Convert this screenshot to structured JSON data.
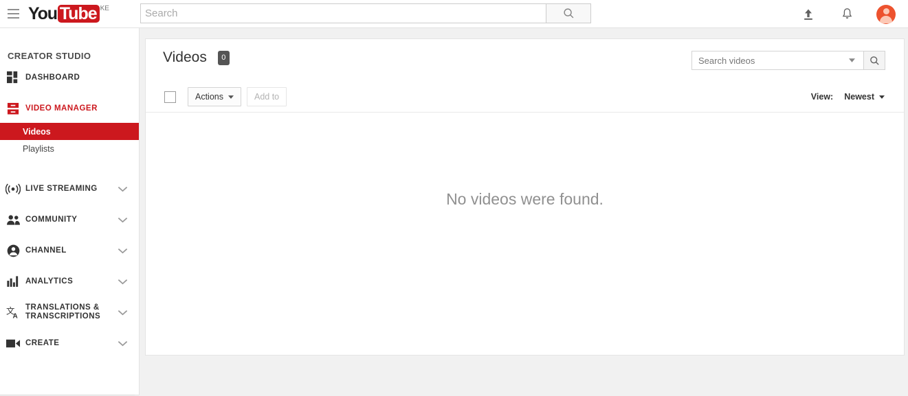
{
  "colors": {
    "brand_red": "#cc181e",
    "badge_gray": "#555555",
    "page_bg": "#f1f1f1",
    "avatar_orange": "#ed522e",
    "empty_text_gray": "#909090"
  },
  "header": {
    "menu_icon": "hamburger-menu-icon",
    "logo_you": "You",
    "logo_tube": "Tube",
    "logo_country_code": "KE",
    "search": {
      "value": "",
      "placeholder": "Search",
      "button_icon": "search-icon"
    },
    "upload_icon": "upload-icon",
    "notifications_icon": "bell-icon",
    "avatar_icon": "account-avatar"
  },
  "sidebar": {
    "title": "CREATOR STUDIO",
    "items": [
      {
        "label": "DASHBOARD",
        "icon": "dashboard-grid-icon",
        "active": false,
        "expandable": false,
        "subitems": []
      },
      {
        "label": "VIDEO MANAGER",
        "icon": "video-manager-icon",
        "active": true,
        "expandable": false,
        "subitems": [
          {
            "label": "Videos",
            "selected": true
          },
          {
            "label": "Playlists",
            "selected": false
          }
        ]
      },
      {
        "label": "LIVE STREAMING",
        "icon": "broadcast-icon",
        "active": false,
        "expandable": true,
        "subitems": []
      },
      {
        "label": "COMMUNITY",
        "icon": "people-icon",
        "active": false,
        "expandable": true,
        "subitems": []
      },
      {
        "label": "CHANNEL",
        "icon": "account-circle-icon",
        "active": false,
        "expandable": true,
        "subitems": []
      },
      {
        "label": "ANALYTICS",
        "icon": "bar-chart-icon",
        "active": false,
        "expandable": true,
        "subitems": []
      },
      {
        "label": "TRANSLATIONS & TRANSCRIPTIONS",
        "icon": "translate-icon",
        "active": false,
        "expandable": true,
        "subitems": []
      },
      {
        "label": "CREATE",
        "icon": "video-camera-icon",
        "active": false,
        "expandable": true,
        "subitems": []
      }
    ]
  },
  "main": {
    "page_title": "Videos",
    "count_badge": "0",
    "videos_search": {
      "value": "",
      "placeholder": "Search videos",
      "caret_icon": "chevron-down-icon",
      "button_icon": "search-icon"
    },
    "toolbar": {
      "select_all_checkbox": "select-all",
      "actions_label": "Actions",
      "actions_caret_icon": "caret-down-icon",
      "add_to_label": "Add to",
      "add_to_disabled": true,
      "view_label": "View:",
      "view_value": "Newest",
      "view_caret_icon": "caret-down-icon"
    },
    "empty_state_text": "No videos were found."
  }
}
